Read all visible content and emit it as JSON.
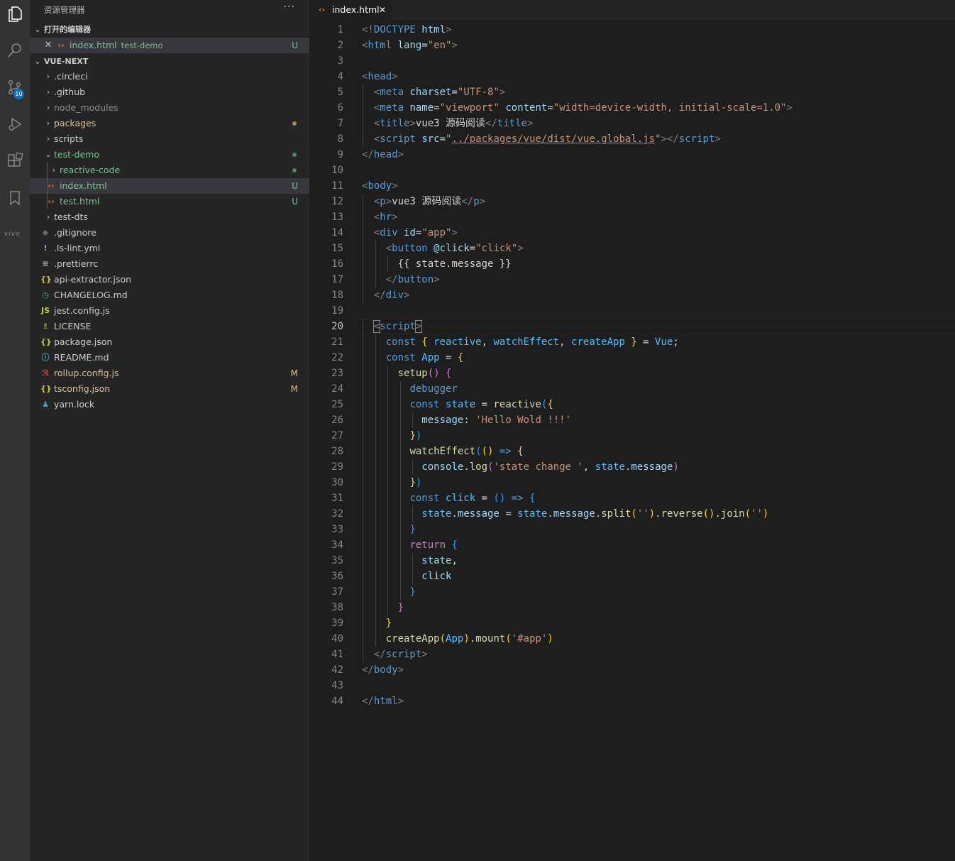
{
  "activity_bar": {
    "icons": [
      "explorer-icon",
      "search-icon",
      "source-control-icon",
      "run-debug-icon",
      "extensions-icon",
      "bookmarks-icon"
    ],
    "scm_badge": "10",
    "vivo_label": "vivo"
  },
  "sidebar": {
    "title": "资源管理器",
    "more": "···",
    "open_editors": {
      "header": "打开的编辑器",
      "items": [
        {
          "name": "index.html",
          "desc": "test-demo",
          "status": "U"
        }
      ]
    },
    "project": {
      "header": "VUE-NEXT",
      "items": [
        {
          "name": ".circleci",
          "type": "folder",
          "depth": 0,
          "expanded": false
        },
        {
          "name": ".github",
          "type": "folder",
          "depth": 0,
          "expanded": false
        },
        {
          "name": "node_modules",
          "type": "folder",
          "depth": 0,
          "expanded": false,
          "ignored": true
        },
        {
          "name": "packages",
          "type": "folder",
          "depth": 0,
          "expanded": false,
          "dot": "#a88a4b"
        },
        {
          "name": "scripts",
          "type": "folder",
          "depth": 0,
          "expanded": false
        },
        {
          "name": "test-demo",
          "type": "folder",
          "depth": 0,
          "expanded": true,
          "dot": "#4a8a5c"
        },
        {
          "name": "reactive-code",
          "type": "folder",
          "depth": 1,
          "expanded": false,
          "dot": "#4a8a5c"
        },
        {
          "name": "index.html",
          "type": "html",
          "depth": 1,
          "status": "U",
          "active": true
        },
        {
          "name": "test.html",
          "type": "html",
          "depth": 1,
          "status": "U"
        },
        {
          "name": "test-dts",
          "type": "folder",
          "depth": 0,
          "expanded": false
        },
        {
          "name": ".gitignore",
          "type": "gitignore",
          "depth": 0
        },
        {
          "name": ".ls-lint.yml",
          "type": "yml",
          "depth": 0
        },
        {
          "name": ".prettierrc",
          "type": "prettier",
          "depth": 0
        },
        {
          "name": "api-extractor.json",
          "type": "json",
          "depth": 0
        },
        {
          "name": "CHANGELOG.md",
          "type": "changelog",
          "depth": 0
        },
        {
          "name": "jest.config.js",
          "type": "js",
          "depth": 0
        },
        {
          "name": "LICENSE",
          "type": "license",
          "depth": 0
        },
        {
          "name": "package.json",
          "type": "json",
          "depth": 0
        },
        {
          "name": "README.md",
          "type": "readme",
          "depth": 0
        },
        {
          "name": "rollup.config.js",
          "type": "rollup",
          "depth": 0,
          "status": "M"
        },
        {
          "name": "tsconfig.json",
          "type": "json",
          "depth": 0,
          "status": "M"
        },
        {
          "name": "yarn.lock",
          "type": "yarn",
          "depth": 0
        }
      ]
    }
  },
  "editor": {
    "tab": {
      "name": "index.html",
      "close": "✕"
    },
    "current_line": 20,
    "lines": [
      [
        [
          "<!",
          "t-punc"
        ],
        [
          "DOCTYPE ",
          "t-tag"
        ],
        [
          "html",
          "t-attr"
        ],
        [
          ">",
          "t-punc"
        ]
      ],
      [
        [
          "<",
          "t-punc"
        ],
        [
          "html ",
          "t-tag"
        ],
        [
          "lang",
          "t-attr"
        ],
        [
          "=",
          "t-text"
        ],
        [
          "\"en\"",
          "t-str"
        ],
        [
          ">",
          "t-punc"
        ]
      ],
      [],
      [
        [
          "<",
          "t-punc"
        ],
        [
          "head",
          "t-tag"
        ],
        [
          ">",
          "t-punc"
        ]
      ],
      [
        [
          "  ",
          ""
        ],
        [
          "<",
          "t-punc"
        ],
        [
          "meta ",
          "t-tag"
        ],
        [
          "charset",
          "t-attr"
        ],
        [
          "=",
          "t-text"
        ],
        [
          "\"UTF-8\"",
          "t-str"
        ],
        [
          ">",
          "t-punc"
        ]
      ],
      [
        [
          "  ",
          ""
        ],
        [
          "<",
          "t-punc"
        ],
        [
          "meta ",
          "t-tag"
        ],
        [
          "name",
          "t-attr"
        ],
        [
          "=",
          "t-text"
        ],
        [
          "\"viewport\"",
          "t-str"
        ],
        [
          " content",
          "t-attr"
        ],
        [
          "=",
          "t-text"
        ],
        [
          "\"width=device-width, initial-scale=1.0\"",
          "t-str"
        ],
        [
          ">",
          "t-punc"
        ]
      ],
      [
        [
          "  ",
          ""
        ],
        [
          "<",
          "t-punc"
        ],
        [
          "title",
          "t-tag"
        ],
        [
          ">",
          "t-punc"
        ],
        [
          "vue3 源码阅读",
          "t-text"
        ],
        [
          "</",
          "t-punc"
        ],
        [
          "title",
          "t-tag"
        ],
        [
          ">",
          "t-punc"
        ]
      ],
      [
        [
          "  ",
          ""
        ],
        [
          "<",
          "t-punc"
        ],
        [
          "script ",
          "t-tag"
        ],
        [
          "src",
          "t-attr"
        ],
        [
          "=",
          "t-text"
        ],
        [
          "\"",
          "t-str"
        ],
        [
          "../packages/vue/dist/vue.global.js",
          "t-link"
        ],
        [
          "\"",
          "t-str"
        ],
        [
          "></",
          "t-punc"
        ],
        [
          "script",
          "t-tag"
        ],
        [
          ">",
          "t-punc"
        ]
      ],
      [
        [
          "</",
          "t-punc"
        ],
        [
          "head",
          "t-tag"
        ],
        [
          ">",
          "t-punc"
        ]
      ],
      [],
      [
        [
          "<",
          "t-punc"
        ],
        [
          "body",
          "t-tag"
        ],
        [
          ">",
          "t-punc"
        ]
      ],
      [
        [
          "  ",
          ""
        ],
        [
          "<",
          "t-punc"
        ],
        [
          "p",
          "t-tag"
        ],
        [
          ">",
          "t-punc"
        ],
        [
          "vue3 源码阅读",
          "t-text"
        ],
        [
          "</",
          "t-punc"
        ],
        [
          "p",
          "t-tag"
        ],
        [
          ">",
          "t-punc"
        ]
      ],
      [
        [
          "  ",
          ""
        ],
        [
          "<",
          "t-punc"
        ],
        [
          "hr",
          "t-tag"
        ],
        [
          ">",
          "t-punc"
        ]
      ],
      [
        [
          "  ",
          ""
        ],
        [
          "<",
          "t-punc"
        ],
        [
          "div ",
          "t-tag"
        ],
        [
          "id",
          "t-attr"
        ],
        [
          "=",
          "t-text"
        ],
        [
          "\"app\"",
          "t-str"
        ],
        [
          ">",
          "t-punc"
        ]
      ],
      [
        [
          "    ",
          ""
        ],
        [
          "<",
          "t-punc"
        ],
        [
          "button ",
          "t-tag"
        ],
        [
          "@click",
          "t-attr"
        ],
        [
          "=",
          "t-text"
        ],
        [
          "\"click\"",
          "t-str"
        ],
        [
          ">",
          "t-punc"
        ]
      ],
      [
        [
          "      ",
          ""
        ],
        [
          "{{ state.message }}",
          "t-text"
        ]
      ],
      [
        [
          "    ",
          ""
        ],
        [
          "</",
          "t-punc"
        ],
        [
          "button",
          "t-tag"
        ],
        [
          ">",
          "t-punc"
        ]
      ],
      [
        [
          "  ",
          ""
        ],
        [
          "</",
          "t-punc"
        ],
        [
          "div",
          "t-tag"
        ],
        [
          ">",
          "t-punc"
        ]
      ],
      [],
      [
        [
          "  ",
          ""
        ],
        [
          "<",
          "t-punc t-bm"
        ],
        [
          "script",
          "t-tag"
        ],
        [
          ">",
          "t-punc t-bm"
        ]
      ],
      [
        [
          "    ",
          ""
        ],
        [
          "const ",
          "t-kw"
        ],
        [
          "{ ",
          "t-b1"
        ],
        [
          "reactive",
          "t-const"
        ],
        [
          ", ",
          "t-op"
        ],
        [
          "watchEffect",
          "t-const"
        ],
        [
          ", ",
          "t-op"
        ],
        [
          "createApp",
          "t-const"
        ],
        [
          " }",
          "t-b1"
        ],
        [
          " = ",
          "t-op"
        ],
        [
          "Vue",
          "t-const"
        ],
        [
          ";",
          "t-op"
        ]
      ],
      [
        [
          "    ",
          ""
        ],
        [
          "const ",
          "t-kw"
        ],
        [
          "App",
          "t-const"
        ],
        [
          " = ",
          "t-op"
        ],
        [
          "{",
          "t-b1"
        ]
      ],
      [
        [
          "      ",
          ""
        ],
        [
          "setup",
          "t-fn"
        ],
        [
          "()",
          "t-b2"
        ],
        [
          " {",
          "t-b2"
        ]
      ],
      [
        [
          "        ",
          ""
        ],
        [
          "debugger",
          "t-kw"
        ]
      ],
      [
        [
          "        ",
          ""
        ],
        [
          "const ",
          "t-kw"
        ],
        [
          "state",
          "t-const"
        ],
        [
          " = ",
          "t-op"
        ],
        [
          "reactive",
          "t-fn"
        ],
        [
          "(",
          "t-b3"
        ],
        [
          "{",
          "t-b1"
        ]
      ],
      [
        [
          "          ",
          ""
        ],
        [
          "message",
          "t-var"
        ],
        [
          ": ",
          "t-op"
        ],
        [
          "'Hello Wold !!!'",
          "t-str"
        ]
      ],
      [
        [
          "        ",
          ""
        ],
        [
          "}",
          "t-b1"
        ],
        [
          ")",
          "t-b3"
        ]
      ],
      [
        [
          "        ",
          ""
        ],
        [
          "watchEffect",
          "t-fn"
        ],
        [
          "(",
          "t-b3"
        ],
        [
          "()",
          "t-b1"
        ],
        [
          " => ",
          "t-kw"
        ],
        [
          "{",
          "t-b1"
        ]
      ],
      [
        [
          "          ",
          ""
        ],
        [
          "console",
          "t-var"
        ],
        [
          ".",
          "t-op"
        ],
        [
          "log",
          "t-fn"
        ],
        [
          "(",
          "t-b2"
        ],
        [
          "'state change '",
          "t-str"
        ],
        [
          ", ",
          "t-op"
        ],
        [
          "state",
          "t-const"
        ],
        [
          ".",
          "t-op"
        ],
        [
          "message",
          "t-var"
        ],
        [
          ")",
          "t-b2"
        ]
      ],
      [
        [
          "        ",
          ""
        ],
        [
          "}",
          "t-b1"
        ],
        [
          ")",
          "t-b3"
        ]
      ],
      [
        [
          "        ",
          ""
        ],
        [
          "const ",
          "t-kw"
        ],
        [
          "click",
          "t-const"
        ],
        [
          " = ",
          "t-op"
        ],
        [
          "()",
          "t-b3"
        ],
        [
          " => ",
          "t-kw"
        ],
        [
          "{",
          "t-b3"
        ]
      ],
      [
        [
          "          ",
          ""
        ],
        [
          "state",
          "t-const"
        ],
        [
          ".",
          "t-op"
        ],
        [
          "message",
          "t-var"
        ],
        [
          " = ",
          "t-op"
        ],
        [
          "state",
          "t-const"
        ],
        [
          ".",
          "t-op"
        ],
        [
          "message",
          "t-var"
        ],
        [
          ".",
          "t-op"
        ],
        [
          "split",
          "t-fn"
        ],
        [
          "(",
          "t-b1"
        ],
        [
          "''",
          "t-str"
        ],
        [
          ")",
          "t-b1"
        ],
        [
          ".",
          "t-op"
        ],
        [
          "reverse",
          "t-fn"
        ],
        [
          "()",
          "t-b1"
        ],
        [
          ".",
          "t-op"
        ],
        [
          "join",
          "t-fn"
        ],
        [
          "(",
          "t-b1"
        ],
        [
          "''",
          "t-str"
        ],
        [
          ")",
          "t-b1"
        ]
      ],
      [
        [
          "        ",
          ""
        ],
        [
          "}",
          "t-b3"
        ]
      ],
      [
        [
          "        ",
          ""
        ],
        [
          "return ",
          "t-ctl"
        ],
        [
          "{",
          "t-b3"
        ]
      ],
      [
        [
          "          ",
          ""
        ],
        [
          "state",
          "t-var"
        ],
        [
          ",",
          "t-op"
        ]
      ],
      [
        [
          "          ",
          ""
        ],
        [
          "click",
          "t-var"
        ]
      ],
      [
        [
          "        ",
          ""
        ],
        [
          "}",
          "t-b3"
        ]
      ],
      [
        [
          "      ",
          ""
        ],
        [
          "}",
          "t-b2"
        ]
      ],
      [
        [
          "    ",
          ""
        ],
        [
          "}",
          "t-b1"
        ]
      ],
      [
        [
          "    ",
          ""
        ],
        [
          "createApp",
          "t-fn"
        ],
        [
          "(",
          "t-b1"
        ],
        [
          "App",
          "t-const"
        ],
        [
          ")",
          "t-b1"
        ],
        [
          ".",
          "t-op"
        ],
        [
          "mount",
          "t-fn"
        ],
        [
          "(",
          "t-b1"
        ],
        [
          "'#app'",
          "t-str"
        ],
        [
          ")",
          "t-b1"
        ]
      ],
      [
        [
          "  ",
          ""
        ],
        [
          "</",
          "t-punc"
        ],
        [
          "script",
          "t-tag"
        ],
        [
          ">",
          "t-punc"
        ]
      ],
      [
        [
          "</",
          "t-punc"
        ],
        [
          "body",
          "t-tag"
        ],
        [
          ">",
          "t-punc"
        ]
      ],
      [],
      [
        [
          "</",
          "t-punc"
        ],
        [
          "html",
          "t-tag"
        ],
        [
          ">",
          "t-punc"
        ]
      ]
    ]
  }
}
